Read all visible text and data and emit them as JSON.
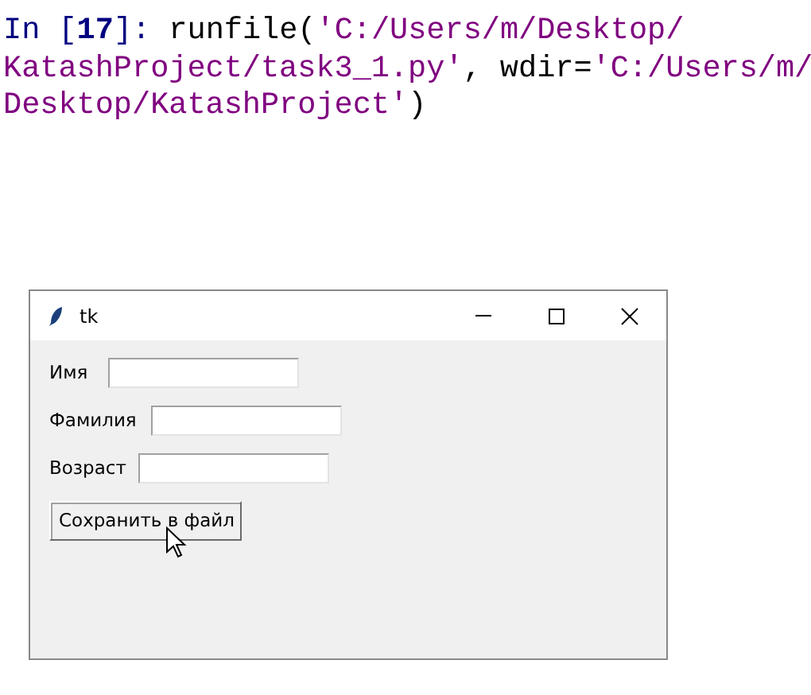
{
  "console": {
    "lines": [
      [
        {
          "kind": "prompt",
          "text": "In ["
        },
        {
          "kind": "number",
          "text": "17"
        },
        {
          "kind": "prompt",
          "text": "]: "
        },
        {
          "kind": "code",
          "text": "runfile("
        },
        {
          "kind": "string",
          "text": "'C:/Users/m/Desktop/"
        }
      ],
      [
        {
          "kind": "string",
          "text": "KatashProject/task3_1.py'"
        },
        {
          "kind": "code",
          "text": ", wdir="
        },
        {
          "kind": "string",
          "text": "'C:/Users/m/"
        }
      ],
      [
        {
          "kind": "string",
          "text": "Desktop/KatashProject'"
        },
        {
          "kind": "code",
          "text": ")"
        }
      ]
    ]
  },
  "window": {
    "title": "tk",
    "fields": [
      {
        "label": "Имя"
      },
      {
        "label": "Фамилия"
      },
      {
        "label": "Возраст"
      }
    ],
    "button": "Сохранить в файл"
  }
}
